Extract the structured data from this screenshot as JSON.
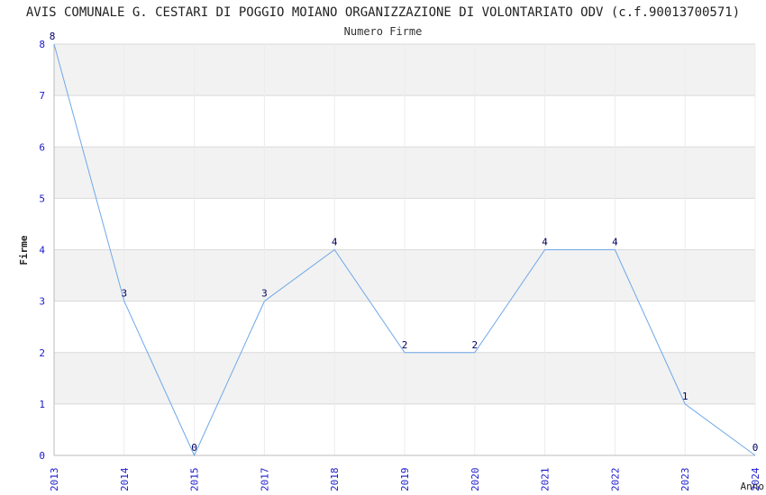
{
  "chart_data": {
    "type": "line",
    "title": "AVIS COMUNALE G. CESTARI DI POGGIO MOIANO ORGANIZZAZIONE DI VOLONTARIATO ODV (c.f.90013700571)",
    "subtitle": "Numero Firme",
    "xlabel": "Anno",
    "ylabel": "Firme",
    "categories": [
      "2013",
      "2014",
      "2015",
      "2017",
      "2018",
      "2019",
      "2020",
      "2021",
      "2022",
      "2023",
      "2024"
    ],
    "values": [
      8,
      3,
      0,
      3,
      4,
      2,
      2,
      4,
      4,
      1,
      0
    ],
    "ylim": [
      0,
      8
    ],
    "yticks": [
      "0",
      "1",
      "2",
      "3",
      "4",
      "5",
      "6",
      "7",
      "8"
    ],
    "grid": true,
    "colors": {
      "line": "#6fa8e8",
      "tick_text": "#1a1acc",
      "band": "#f2f2f2",
      "grid": "#d9d9d9",
      "data_label": "#000066"
    }
  }
}
